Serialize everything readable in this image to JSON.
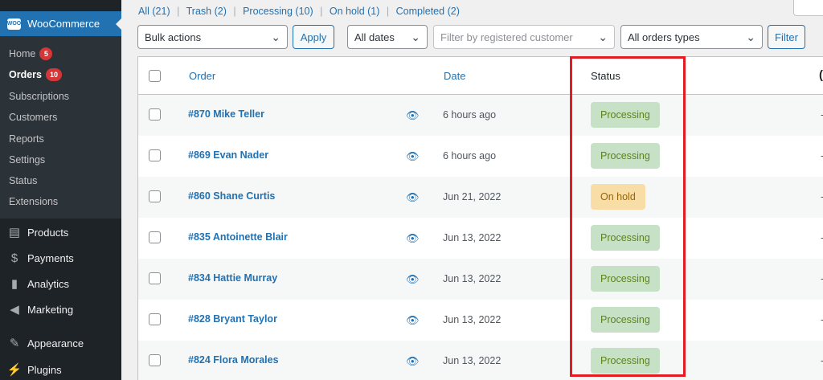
{
  "sidebar": {
    "woocommerce_label": "WooCommerce",
    "logo_text": "WOO",
    "submenu": [
      {
        "label": "Home",
        "badge": "5"
      },
      {
        "label": "Orders",
        "badge": "10"
      },
      {
        "label": "Subscriptions"
      },
      {
        "label": "Customers"
      },
      {
        "label": "Reports"
      },
      {
        "label": "Settings"
      },
      {
        "label": "Status"
      },
      {
        "label": "Extensions"
      }
    ],
    "menu": [
      {
        "label": "Products",
        "icon": "archive-icon"
      },
      {
        "label": "Payments",
        "icon": "dollar-icon"
      },
      {
        "label": "Analytics",
        "icon": "bar-chart-icon"
      },
      {
        "label": "Marketing",
        "icon": "megaphone-icon"
      },
      {
        "label": "Appearance",
        "icon": "paintbrush-icon"
      },
      {
        "label": "Plugins",
        "icon": "plugin-icon"
      }
    ]
  },
  "views": {
    "all": "All",
    "all_count": "(21)",
    "trash": "Trash",
    "trash_count": "(2)",
    "processing": "Processing",
    "processing_count": "(10)",
    "on_hold": "On hold",
    "on_hold_count": "(1)",
    "completed": "Completed",
    "completed_count": "(2)",
    "separator": "|"
  },
  "filters": {
    "bulk_actions": "Bulk actions",
    "apply": "Apply",
    "all_dates": "All dates",
    "customer_placeholder": "Filter by registered customer",
    "order_types": "All orders types",
    "filter": "Filter"
  },
  "table": {
    "headers": {
      "order": "Order",
      "date": "Date",
      "status": "Status",
      "extra": "("
    },
    "rows": [
      {
        "order": "#870 Mike Teller",
        "date": "6 hours ago",
        "status": "Processing"
      },
      {
        "order": "#869 Evan Nader",
        "date": "6 hours ago",
        "status": "Processing"
      },
      {
        "order": "#860 Shane Curtis",
        "date": "Jun 21, 2022",
        "status": "On hold"
      },
      {
        "order": "#835 Antoinette Blair",
        "date": "Jun 13, 2022",
        "status": "Processing"
      },
      {
        "order": "#834 Hattie Murray",
        "date": "Jun 13, 2022",
        "status": "Processing"
      },
      {
        "order": "#828 Bryant Taylor",
        "date": "Jun 13, 2022",
        "status": "Processing"
      },
      {
        "order": "#824 Flora Morales",
        "date": "Jun 13, 2022",
        "status": "Processing"
      }
    ],
    "dash": "-"
  },
  "colors": {
    "accent": "#2271b1",
    "processing_bg": "#c6e1c6",
    "onhold_bg": "#f8dda7",
    "highlight": "#e31b23"
  }
}
